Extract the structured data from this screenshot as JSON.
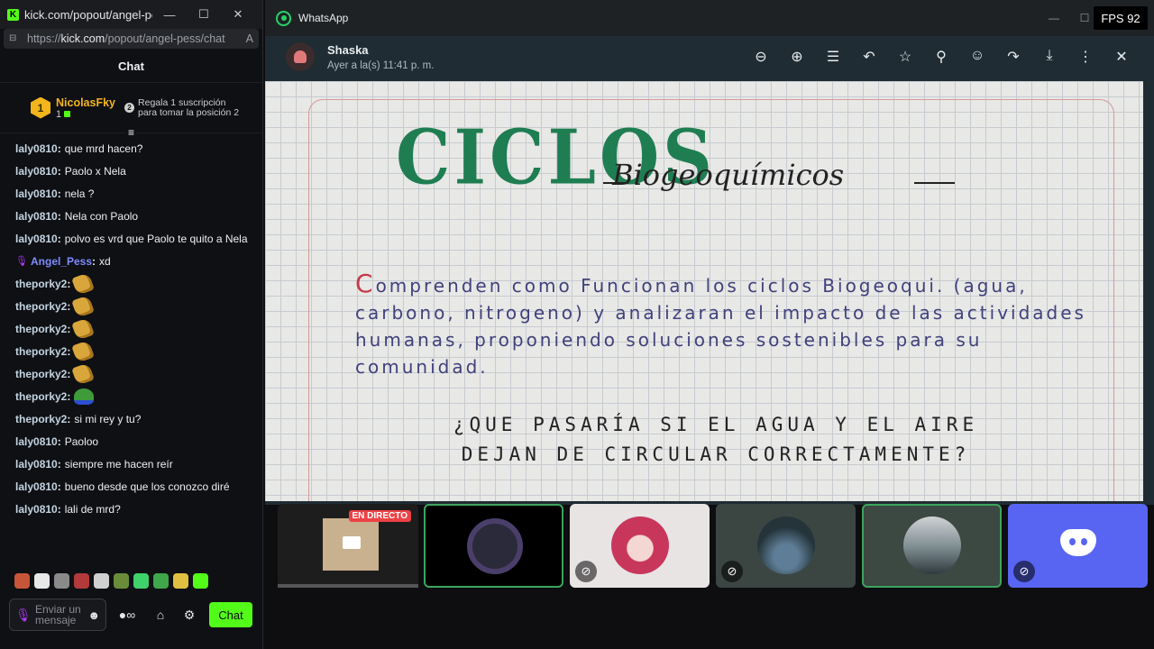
{
  "browser": {
    "title": "kick.com/popout/angel-pes...",
    "url_prefix": "https://",
    "url_domain": "kick.com",
    "url_path": "/popout/angel-pess/chat",
    "reader_label": "A",
    "min": "—",
    "max": "☐",
    "close": "✕"
  },
  "chat": {
    "header": "Chat",
    "leaderboard": {
      "rank": "1",
      "name": "NicolasFky",
      "count": "1",
      "cta_num": "2",
      "cta_text": "Regala 1 suscripción para tomar la posición 2"
    },
    "messages": [
      {
        "user": "laly0810",
        "text": "que mrd hacen?"
      },
      {
        "user": "laly0810",
        "text": "Paolo x Nela"
      },
      {
        "user": "laly0810",
        "text": "nela ?"
      },
      {
        "user": "laly0810",
        "text": "Nela con Paolo"
      },
      {
        "user": "laly0810",
        "text": "polvo es vrd que Paolo te quito a Nela"
      },
      {
        "user": "Angel_Pess",
        "text": "xd"
      },
      {
        "user": "theporky2",
        "text": ""
      },
      {
        "user": "theporky2",
        "text": ""
      },
      {
        "user": "theporky2",
        "text": ""
      },
      {
        "user": "theporky2",
        "text": ""
      },
      {
        "user": "theporky2",
        "text": ""
      },
      {
        "user": "theporky2",
        "text": ""
      },
      {
        "user": "theporky2",
        "text": "si mi rey y tu?"
      },
      {
        "user": "laly0810",
        "text": "Paoloo"
      },
      {
        "user": "laly0810",
        "text": "siempre me hacen reír"
      },
      {
        "user": "laly0810",
        "text": "bueno desde que los conozco diré"
      },
      {
        "user": "laly0810",
        "text": "lali de mrd?"
      }
    ],
    "input_placeholder": "Enviar un mensaje",
    "send_label": "Chat"
  },
  "whatsapp": {
    "app_title": "WhatsApp",
    "fps": "FPS 92",
    "contact_name": "Shaska",
    "contact_time": "Ayer a la(s) 11:41 p. m.",
    "notebook": {
      "title": "CICLOS",
      "subtitle": "Biogeoquímicos",
      "paragraph_first": "C",
      "paragraph": "omprenden como Funcionan los ciclos Biogeoqui. (agua, carbono, nitrogeno) y analizaran el impacto de las actividades humanas, proponiendo soluciones sostenibles para su comunidad.",
      "question": "¿QUE PASARÍA SI EL AGUA Y EL AIRE DEJAN DE CIRCULAR CORRECTAMENTE?"
    }
  },
  "discord": {
    "live_badge": "EN DIRECTO"
  },
  "colors": {
    "kick_green": "#53fc18",
    "discord_blurple": "#5865f2",
    "whatsapp_green": "#25d366"
  }
}
